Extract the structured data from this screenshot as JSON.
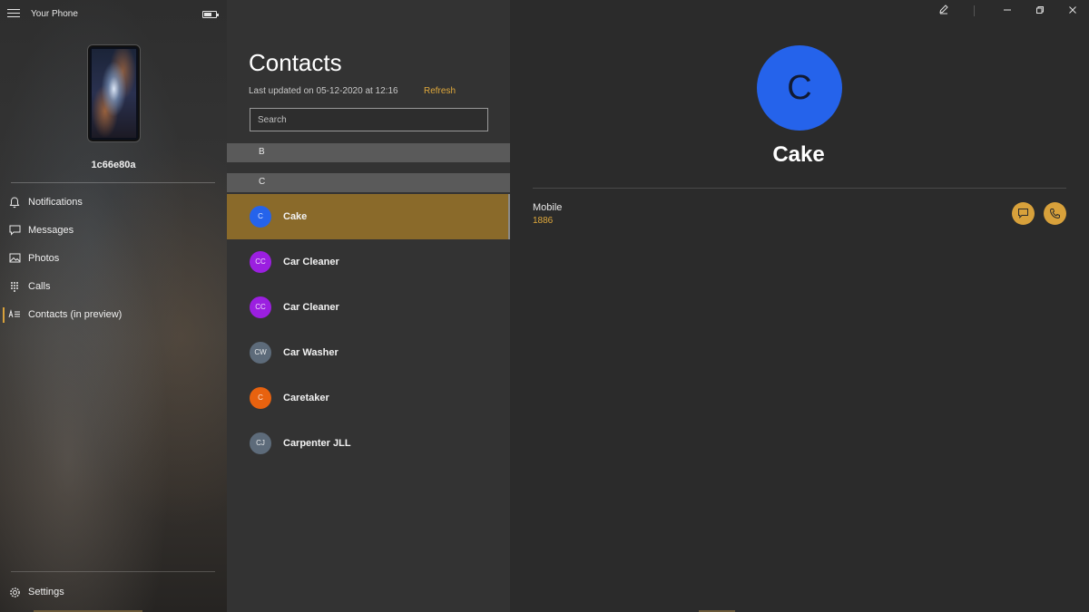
{
  "app": {
    "title": "Your Phone"
  },
  "device": {
    "name": "1c66e80a"
  },
  "sidebar": {
    "items": [
      {
        "label": "Notifications",
        "icon": "bell-icon",
        "active": false
      },
      {
        "label": "Messages",
        "icon": "message-icon",
        "active": false
      },
      {
        "label": "Photos",
        "icon": "photos-icon",
        "active": false
      },
      {
        "label": "Calls",
        "icon": "dialpad-icon",
        "active": false
      },
      {
        "label": "Contacts (in preview)",
        "icon": "contacts-icon",
        "active": true
      }
    ],
    "settings_label": "Settings"
  },
  "contacts": {
    "title": "Contacts",
    "last_updated": "Last updated on 05-12-2020 at 12:16",
    "refresh_label": "Refresh",
    "search_placeholder": "Search",
    "groups": [
      {
        "letter": "B",
        "contacts": []
      },
      {
        "letter": "C",
        "contacts": [
          {
            "name": "Cake",
            "initials": "C",
            "color": "#2563eb",
            "selected": true
          },
          {
            "name": "Car Cleaner",
            "initials": "CC",
            "color": "#9b1fe0",
            "selected": false
          },
          {
            "name": "Car Cleaner",
            "initials": "CC",
            "color": "#9b1fe0",
            "selected": false
          },
          {
            "name": "Car Washer",
            "initials": "CW",
            "color": "#5d6b7a",
            "selected": false
          },
          {
            "name": "Caretaker",
            "initials": "C",
            "color": "#e8620f",
            "selected": false
          },
          {
            "name": "Carpenter JLL",
            "initials": "CJ",
            "color": "#5d6b7a",
            "selected": false
          }
        ]
      }
    ]
  },
  "detail": {
    "initial": "C",
    "avatar_color": "#2563eb",
    "name": "Cake",
    "phone_type": "Mobile",
    "phone_number": "1886"
  },
  "colors": {
    "accent": "#d8a13b",
    "selected_row": "#8a6a2a"
  }
}
